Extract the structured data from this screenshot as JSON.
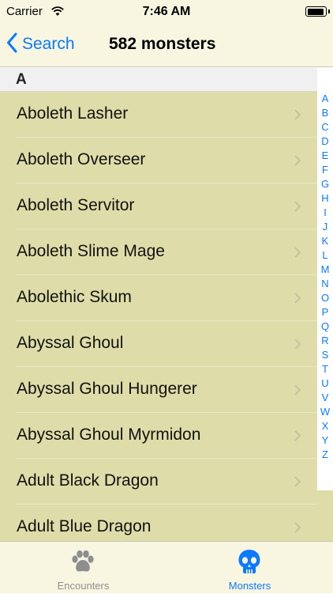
{
  "status_bar": {
    "carrier": "Carrier",
    "time": "7:46 AM",
    "battery_level": 0.95
  },
  "nav": {
    "back_label": "Search",
    "title": "582 monsters"
  },
  "section": {
    "letter": "A"
  },
  "list": {
    "items": [
      {
        "label": "Aboleth Lasher"
      },
      {
        "label": "Aboleth Overseer"
      },
      {
        "label": "Aboleth Servitor"
      },
      {
        "label": "Aboleth Slime Mage"
      },
      {
        "label": "Abolethic Skum"
      },
      {
        "label": "Abyssal Ghoul"
      },
      {
        "label": "Abyssal Ghoul Hungerer"
      },
      {
        "label": "Abyssal Ghoul Myrmidon"
      },
      {
        "label": "Adult Black Dragon"
      },
      {
        "label": "Adult Blue Dragon"
      }
    ]
  },
  "index": {
    "letters": [
      "A",
      "B",
      "C",
      "D",
      "E",
      "F",
      "G",
      "H",
      "I",
      "J",
      "K",
      "L",
      "M",
      "N",
      "O",
      "P",
      "Q",
      "R",
      "S",
      "T",
      "U",
      "V",
      "W",
      "X",
      "Y",
      "Z"
    ]
  },
  "tabs": {
    "encounters": {
      "label": "Encounters",
      "icon": "paw-icon"
    },
    "monsters": {
      "label": "Monsters",
      "icon": "skull-icon"
    }
  },
  "colors": {
    "accent": "#0a7aff",
    "bar_background": "#f8f6e1",
    "list_background": "#dedda9",
    "section_background": "#f1f0f1",
    "inactive_tab": "#8e8e8e"
  }
}
